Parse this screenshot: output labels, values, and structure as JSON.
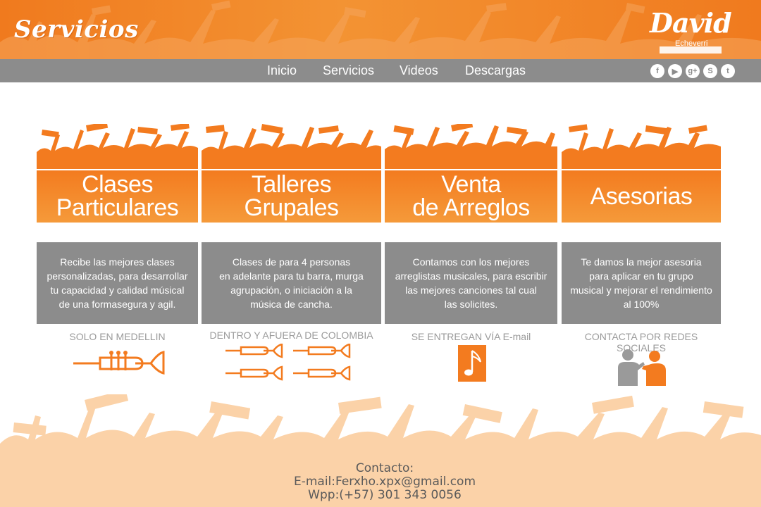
{
  "header": {
    "title": "Servicios",
    "logo_main": "David",
    "logo_sub": "Echeverri"
  },
  "nav": {
    "items": [
      "Inicio",
      "Servicios",
      "Videos",
      "Descargas"
    ],
    "social_icons": [
      "facebook-icon",
      "youtube-icon",
      "google-plus-icon",
      "skype-icon",
      "twitter-icon"
    ]
  },
  "colors": {
    "orange": "#f37b1f",
    "orange_light": "#f59a3a",
    "gray": "#8c8c8c",
    "footer_crowd": "#fbd2a8"
  },
  "services": [
    {
      "title": "Clases\nParticulares",
      "description": "Recibe las mejores clases\npersonalizadas, para desarrollar\ntu capacidad  y calidad músical\nde una formasegura y agil.",
      "note": "SOLO EN MEDELLIN",
      "icon": "trumpet-icon"
    },
    {
      "title": "Talleres\nGrupales",
      "description": "Clases de para 4 personas\nen adelante para tu barra, murga\nagrupación, o iniciación a la\nmúsica de cancha.",
      "note": "DENTRO Y AFUERA DE COLOMBIA",
      "icon": "four-trumpets-icon"
    },
    {
      "title": "Venta\nde Arreglos",
      "description": "Contamos con los mejores\narreglistas musicales, para escribir\nlas mejores canciones tal cual\nlas solicites.",
      "note": "SE ENTREGAN VÍA E-mail",
      "icon": "music-note-icon"
    },
    {
      "title": "Asesorias",
      "description": "Te damos la mejor asesoria\npara aplicar en tu grupo\nmusical y mejorar el rendimiento\nal 100%",
      "note": "CONTACTA POR REDES SOCIALES",
      "icon": "two-people-talking-icon"
    }
  ],
  "footer": {
    "contact_label": "Contacto:",
    "email_line": "E-mail:Ferxho.xpx@gmail.com",
    "phone_line": "Wpp:(+57) 301 343 0056"
  }
}
